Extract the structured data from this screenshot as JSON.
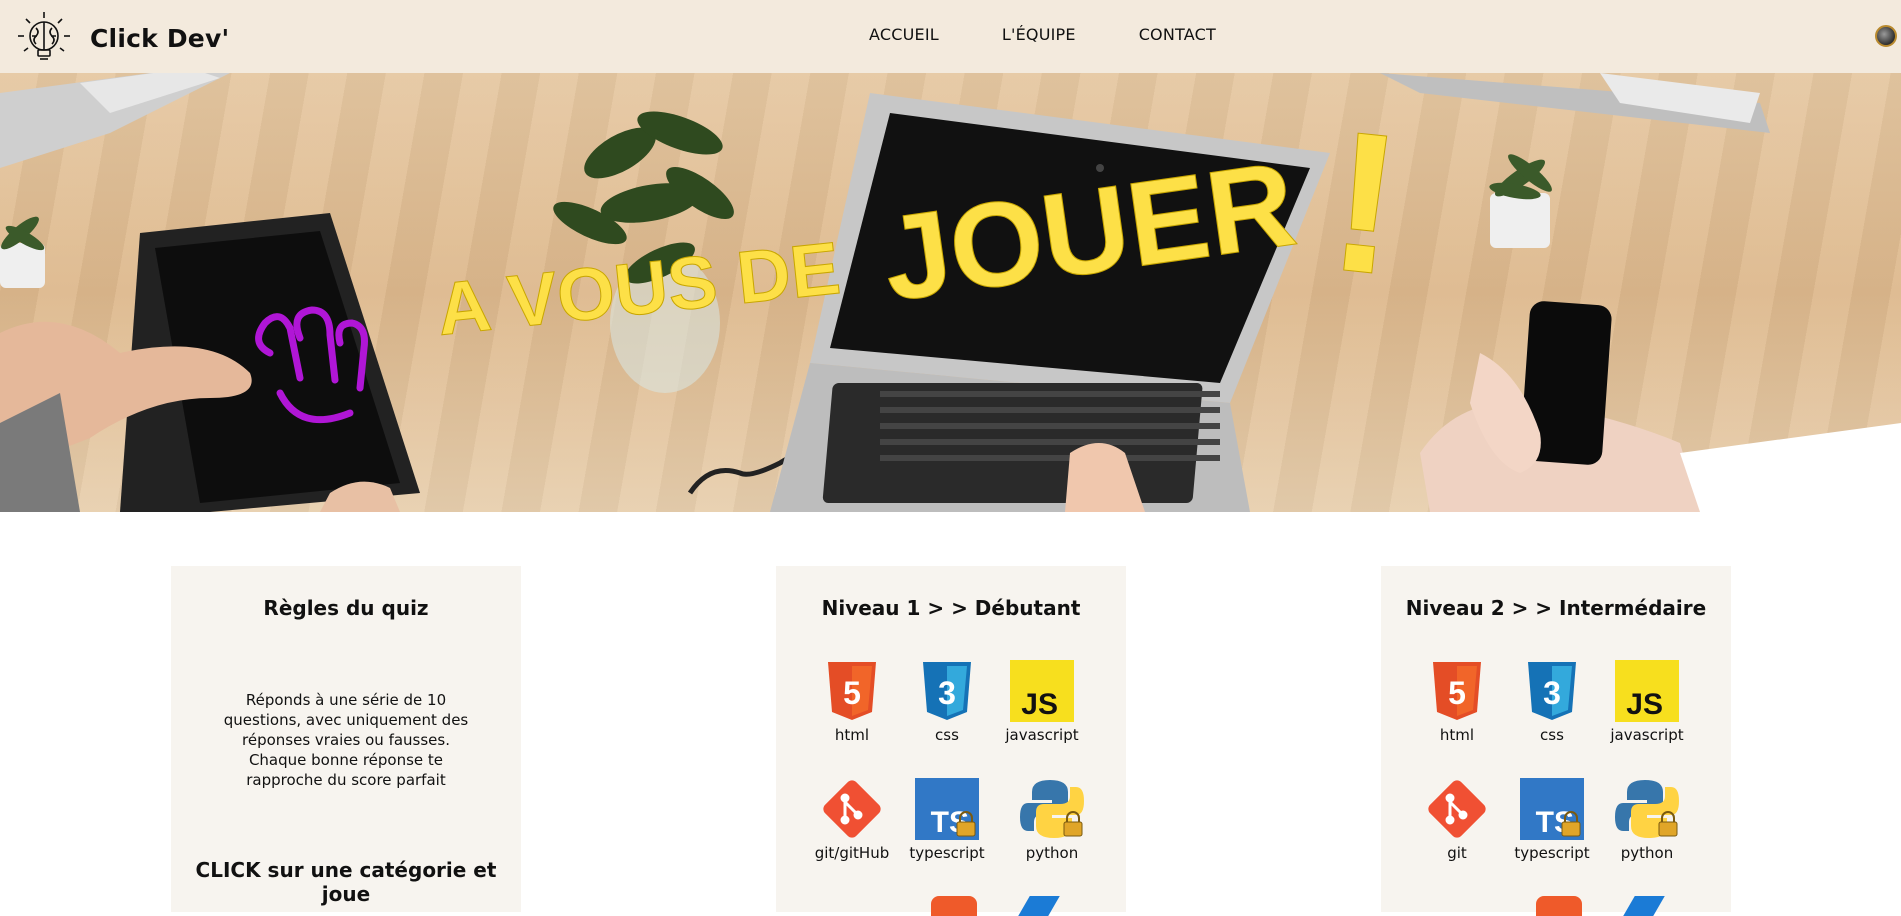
{
  "header": {
    "brand_name": "Click Dev'",
    "nav": [
      {
        "label": "ACCUEIL"
      },
      {
        "label": "L'ÉQUIPE"
      },
      {
        "label": "CONTACT"
      }
    ]
  },
  "hero": {
    "title_small": "A VOUS DE",
    "title_big": "JOUER",
    "title_mark": "!"
  },
  "rules": {
    "title": "Règles du quiz",
    "text": "Réponds à une série de 10 questions, avec uniquement des réponses vraies ou fausses. Chaque bonne réponse te rapproche du score parfait",
    "cta": "CLICK sur une catégorie et joue"
  },
  "level1": {
    "title": "Niveau 1 > > Débutant",
    "items": [
      {
        "label": "html",
        "icon": "html5-icon"
      },
      {
        "label": "css",
        "icon": "css3-icon"
      },
      {
        "label": "javascript",
        "icon": "javascript-icon"
      },
      {
        "label": "git/gitHub",
        "icon": "git-icon"
      },
      {
        "label": "typescript",
        "icon": "typescript-icon"
      },
      {
        "label": "python",
        "icon": "python-icon"
      }
    ]
  },
  "level2": {
    "title": "Niveau 2 > > Intermédaire",
    "items": [
      {
        "label": "html",
        "icon": "html5-icon"
      },
      {
        "label": "css",
        "icon": "css3-icon"
      },
      {
        "label": "javascript",
        "icon": "javascript-icon"
      },
      {
        "label": "git",
        "icon": "git-icon"
      },
      {
        "label": "typescript",
        "icon": "typescript-icon"
      },
      {
        "label": "python",
        "icon": "python-icon"
      }
    ]
  },
  "colors": {
    "header_bg": "#f3eadd",
    "card_bg": "#f7f4ef",
    "hero_text": "#fde047",
    "html": "#e44d26",
    "css": "#1572b6",
    "js": "#f7df1e",
    "git": "#f05033",
    "ts": "#3178c6"
  }
}
